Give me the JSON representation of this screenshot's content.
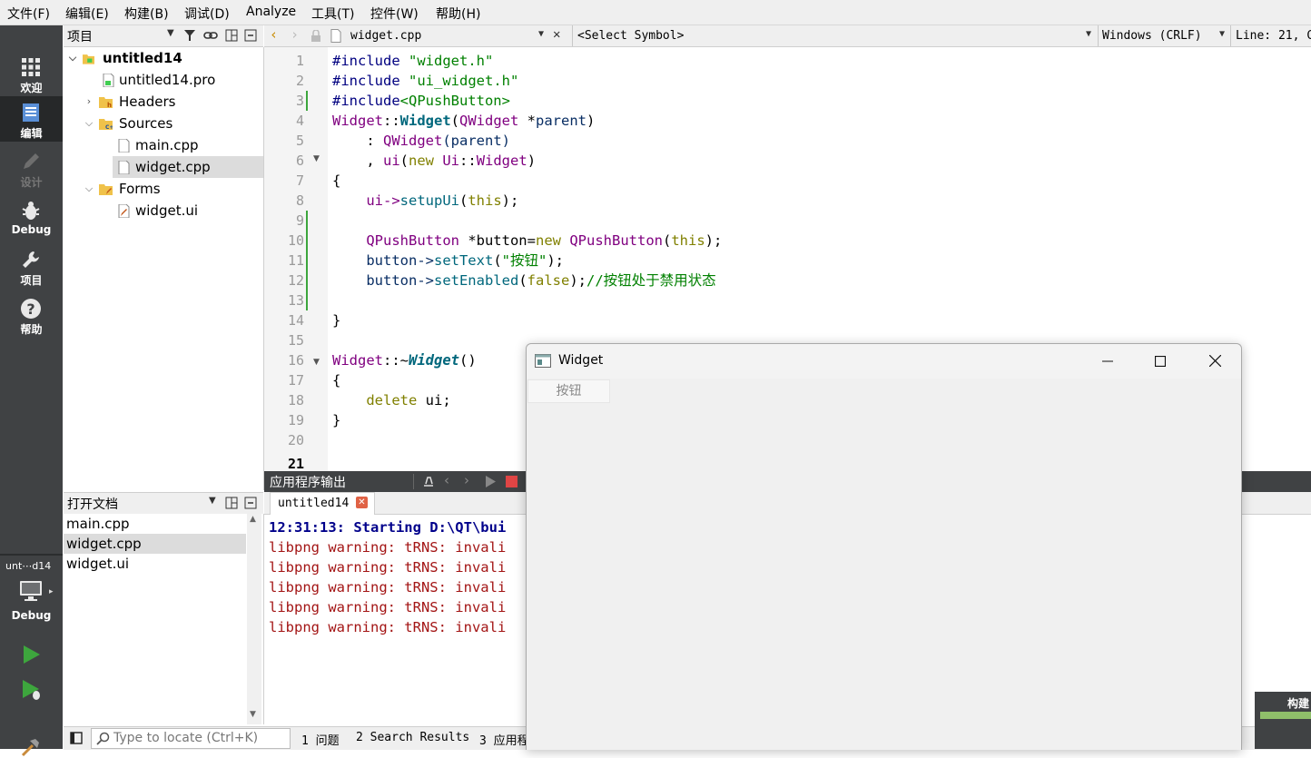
{
  "menu": [
    "文件(F)",
    "编辑(E)",
    "构建(B)",
    "调试(D)",
    "Analyze",
    "工具(T)",
    "控件(W)",
    "帮助(H)"
  ],
  "modes": [
    {
      "label": "欢迎",
      "icon": "grid-icon"
    },
    {
      "label": "编辑",
      "icon": "edit-icon"
    },
    {
      "label": "设计",
      "icon": "pencil-icon"
    },
    {
      "label": "Debug",
      "icon": "bug-icon"
    },
    {
      "label": "项目",
      "icon": "wrench-icon"
    },
    {
      "label": "帮助",
      "icon": "help-icon"
    }
  ],
  "kit": {
    "name": "unt⋯d14",
    "mode": "Debug"
  },
  "project_panel": {
    "title": "项目"
  },
  "tree": {
    "root": "untitled14",
    "pro": "untitled14.pro",
    "headers": "Headers",
    "sources": "Sources",
    "main_cpp": "main.cpp",
    "widget_cpp": "widget.cpp",
    "forms": "Forms",
    "widget_ui": "widget.ui"
  },
  "open_docs": {
    "title": "打开文档",
    "items": [
      "main.cpp",
      "widget.cpp",
      "widget.ui"
    ]
  },
  "editor": {
    "file": "widget.cpp",
    "symbol": "<Select Symbol>",
    "line_ending": "Windows (CRLF)",
    "position": "Line: 21, C"
  },
  "code": {
    "l1a": "#include ",
    "l1b": "\"widget.h\"",
    "l2a": "#include ",
    "l2b": "\"ui_widget.h\"",
    "l3a": "#include",
    "l3b": "<QPushButton>",
    "l4a": "Widget",
    "l4b": "::",
    "l4c": "Widget",
    "l4d": "(",
    "l4e": "QWidget",
    "l4f": " *",
    "l4g": "parent",
    "l4h": ")",
    "l5a": "    : ",
    "l5b": "QWidget",
    "l5c": "(parent)",
    "l6a": "    , ",
    "l6b": "ui",
    "l6c": "(",
    "l6d": "new",
    "l6e": " Ui",
    "l6f": "::",
    "l6g": "Widget",
    "l6h": ")",
    "l7": "{",
    "l8a": "    ui->",
    "l8b": "setupUi",
    "l8c": "(",
    "l8d": "this",
    "l8e": ");",
    "l10a": "    ",
    "l10b": "QPushButton",
    "l10c": " *button=",
    "l10d": "new",
    "l10e": " ",
    "l10f": "QPushButton",
    "l10g": "(",
    "l10h": "this",
    "l10i": ");",
    "l11a": "    button->",
    "l11b": "setText",
    "l11c": "(",
    "l11d": "\"按钮\"",
    "l11e": ");",
    "l12a": "    button->",
    "l12b": "setEnabled",
    "l12c": "(",
    "l12d": "false",
    "l12e": ");",
    "l12f": "//按钮处于禁用状态",
    "l14": "}",
    "l16a": "Widget",
    "l16b": "::~",
    "l16c": "Widget",
    "l16d": "()",
    "l17": "{",
    "l18a": "    ",
    "l18b": "delete",
    "l18c": " ui;",
    "l19": "}"
  },
  "line_numbers": [
    "1",
    "2",
    "3",
    "4",
    "5",
    "6",
    "7",
    "8",
    "9",
    "10",
    "11",
    "12",
    "13",
    "14",
    "15",
    "16",
    "17",
    "18",
    "19",
    "20",
    "21"
  ],
  "output": {
    "title": "应用程序输出",
    "tab": "untitled14",
    "lines": [
      "12:31:13: Starting D:\\QT\\bui",
      "libpng warning: tRNS: invali",
      "libpng warning: tRNS: invali",
      "libpng warning: tRNS: invali",
      "libpng warning: tRNS: invali",
      "libpng warning: tRNS: invali"
    ]
  },
  "status": {
    "locate_placeholder": "Type to locate (Ctrl+K)",
    "tab1": "1 问题",
    "tab2": "2 Search Results",
    "tab3": "3 应用程"
  },
  "widget_window": {
    "title": "Widget",
    "button": "按钮"
  },
  "build_panel": {
    "label": "构建"
  },
  "colors": {
    "dark": "#404244",
    "accent_green": "#3da63d",
    "error_red": "#a31515",
    "blue_bold": "#00008b"
  }
}
